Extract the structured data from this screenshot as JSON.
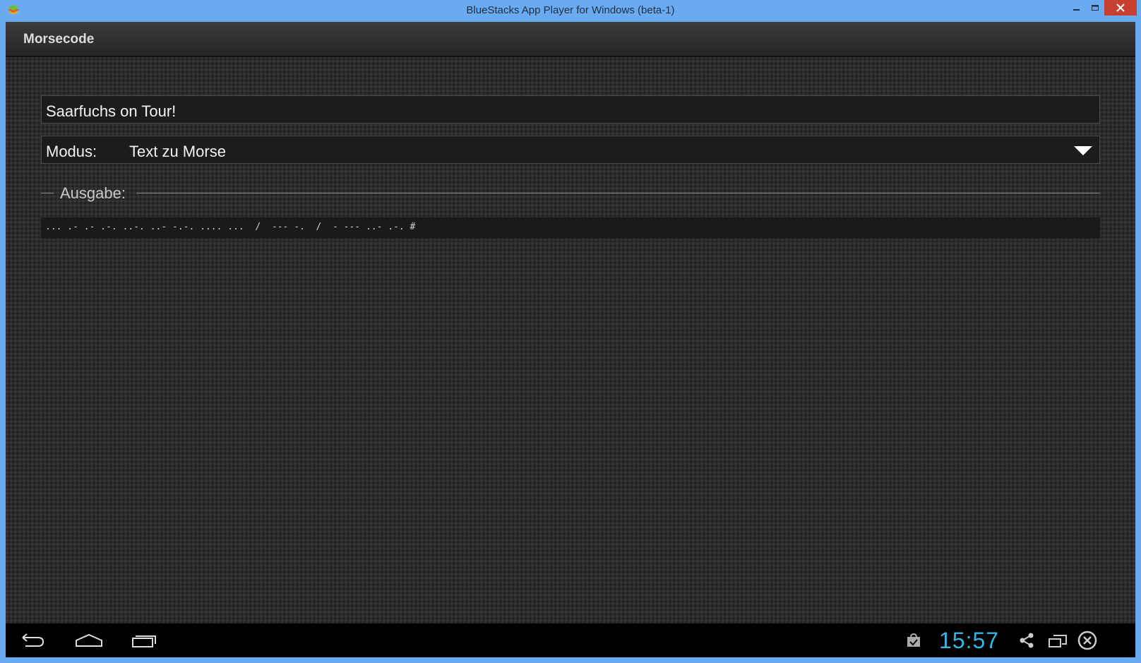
{
  "window": {
    "title": "BlueStacks App Player for Windows (beta-1)"
  },
  "app": {
    "title": "Morsecode"
  },
  "input": {
    "value": "Saarfuchs on Tour!"
  },
  "mode": {
    "label": "Modus:",
    "value": "Text zu Morse"
  },
  "output": {
    "header": "Ausgabe:",
    "text": "... .- .- .-. ..-. ..- -.-. .... ...  /  --- -.  /  - --- ..- .-. #"
  },
  "navbar": {
    "time": "15:57",
    "icons": [
      "back-icon",
      "home-icon",
      "recent-apps-icon",
      "store-icon",
      "share-icon",
      "window-icon",
      "close-app-icon"
    ]
  },
  "colors": {
    "titlebar": "#6aaaf0",
    "clock": "#33b5e5",
    "close": "#c84031"
  }
}
